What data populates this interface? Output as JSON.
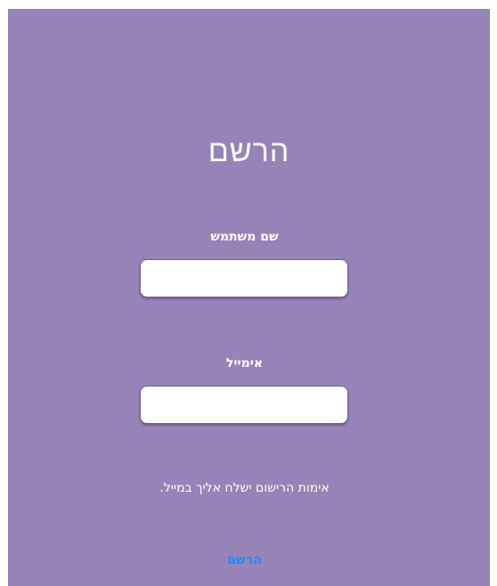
{
  "form": {
    "title": "הרשם",
    "username_label": "שם משתמש",
    "username_value": "",
    "email_label": "אימייל",
    "email_value": "",
    "info_text": "אימות הרישום ישלח אליך במייל.",
    "submit_label": "הרשם"
  },
  "colors": {
    "background": "#9683b7",
    "text": "#ffffff",
    "link": "#1a8cff"
  }
}
